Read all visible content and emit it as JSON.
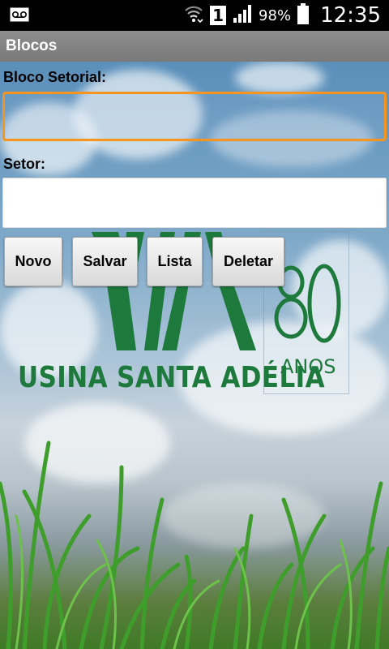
{
  "status_bar": {
    "battery_percent": "98%",
    "time": "12:35",
    "sim_slot": "1",
    "icons": [
      "voicemail-icon",
      "wifi-icon",
      "sim-icon",
      "signal-icon",
      "battery-icon"
    ]
  },
  "app": {
    "title": "Blocos"
  },
  "form": {
    "bloco_setorial_label": "Bloco Setorial:",
    "bloco_setorial_value": "",
    "setor_label": "Setor:",
    "setor_value": ""
  },
  "buttons": {
    "novo": "Novo",
    "salvar": "Salvar",
    "lista": "Lista",
    "deletar": "Deletar"
  },
  "logo": {
    "company": "USINA SANTA ADÉLIA",
    "anniversary_number": "80",
    "anniversary_word": "ANOS",
    "color": "#1d7a3c"
  },
  "colors": {
    "focus": "#f7941d",
    "action_bar": "#858585"
  }
}
